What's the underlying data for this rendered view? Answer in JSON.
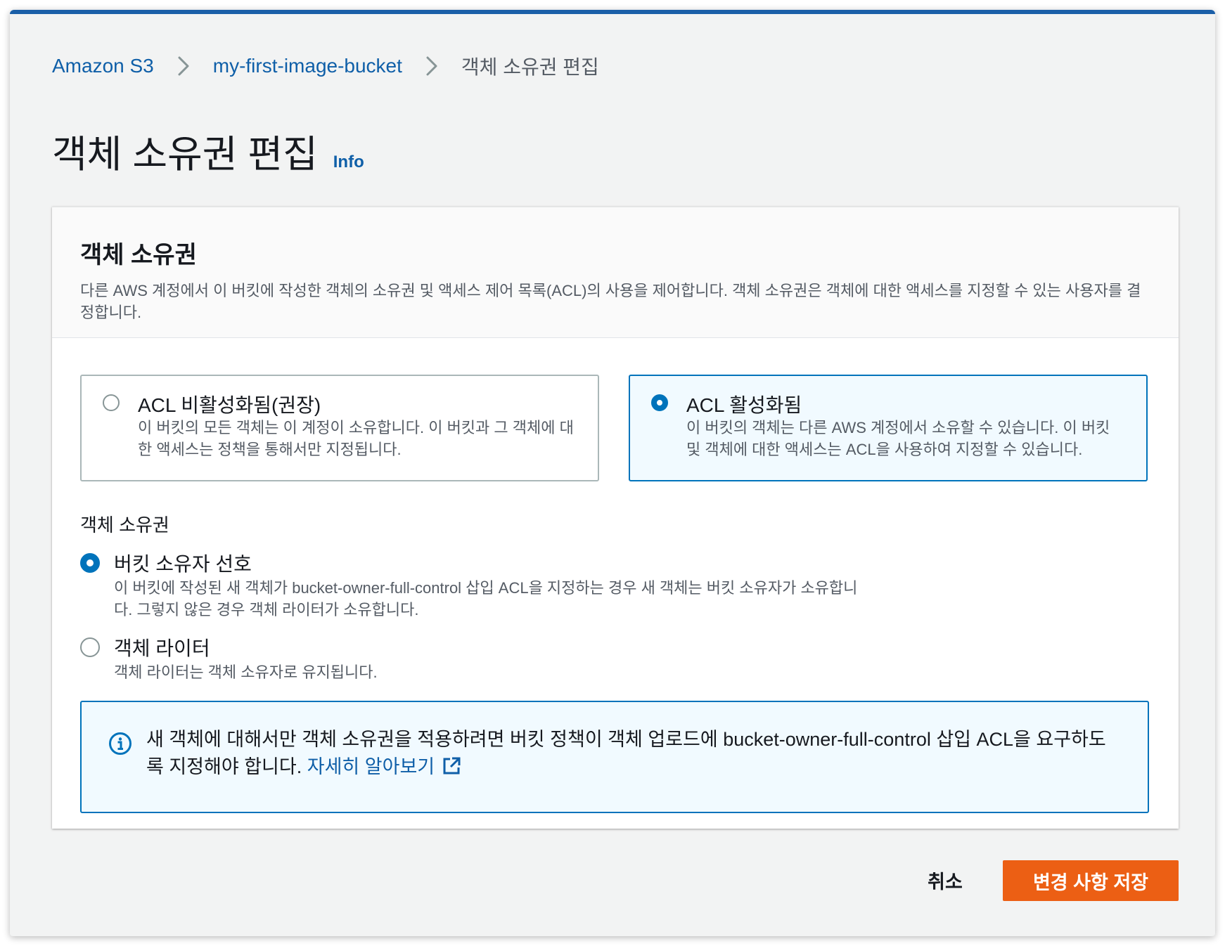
{
  "breadcrumb": {
    "items": [
      "Amazon S3",
      "my-first-image-bucket"
    ],
    "current": "객체 소유권 편집"
  },
  "page": {
    "title": "객체 소유권 편집",
    "info_label": "Info"
  },
  "panel": {
    "title": "객체 소유권",
    "description": "다른 AWS 계정에서 이 버킷에 작성한 객체의 소유권 및 액세스 제어 목록(ACL)의 사용을 제어합니다. 객체 소유권은 객체에 대한 액세스를 지정할 수 있는 사용자를 결정합니다."
  },
  "acl_tiles": [
    {
      "title": "ACL 비활성화됨(권장)",
      "description": "이 버킷의 모든 객체는 이 계정이 소유합니다. 이 버킷과 그 객체에 대한 액세스는 정책을 통해서만 지정됩니다.",
      "selected": false
    },
    {
      "title": "ACL 활성화됨",
      "description": "이 버킷의 객체는 다른 AWS 계정에서 소유할 수 있습니다. 이 버킷 및 객체에 대한 액세스는 ACL을 사용하여 지정할 수 있습니다.",
      "selected": true
    }
  ],
  "ownership": {
    "label": "객체 소유권",
    "options": [
      {
        "title": "버킷 소유자 선호",
        "description": "이 버킷에 작성된 새 객체가 bucket-owner-full-control 삽입 ACL을 지정하는 경우 새 객체는 버킷 소유자가 소유합니다. 그렇지 않은 경우 객체 라이터가 소유합니다.",
        "selected": true
      },
      {
        "title": "객체 라이터",
        "description": "객체 라이터는 객체 소유자로 유지됩니다.",
        "selected": false
      }
    ]
  },
  "alert": {
    "text": "새 객체에 대해서만 객체 소유권을 적용하려면 버킷 정책이 객체 업로드에 bucket-owner-full-control 삽입 ACL을 요구하도록 지정해야 합니다.",
    "link_label": "자세히 알아보기",
    "icon": "info-circle-icon"
  },
  "actions": {
    "cancel_label": "취소",
    "save_label": "변경 사항 저장"
  },
  "colors": {
    "accent": "#0073bb",
    "link": "#0f5fa8",
    "primary_button": "#ec5f14",
    "top_bar": "#1b5fa8"
  }
}
